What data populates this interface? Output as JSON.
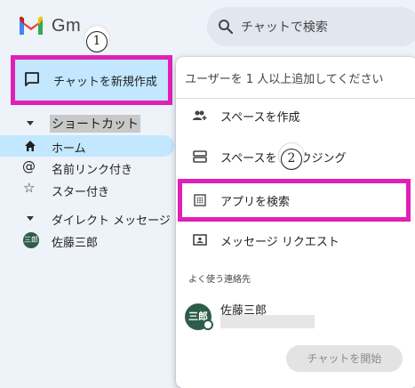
{
  "header": {
    "logo_text": "Gm",
    "search_placeholder": "チャットで検索"
  },
  "callouts": [
    "1",
    "2"
  ],
  "sidebar": {
    "new_chat_label": "チャットを新規作成",
    "items": [
      {
        "label": "ショートカット",
        "icon": "caret-down-icon"
      },
      {
        "label": "ホーム",
        "icon": "home-icon",
        "selected": true
      },
      {
        "label": "名前リンク付き",
        "icon": "at-icon"
      },
      {
        "label": "スター付き",
        "icon": "star-icon"
      },
      {
        "label": "ダイレクト メッセージ",
        "icon": "caret-down-icon"
      },
      {
        "label": "佐藤三郎",
        "icon": "avatar"
      }
    ],
    "avatar_text": "三郎"
  },
  "menu": {
    "input_placeholder": "ユーザーを 1 人以上追加してください",
    "items": [
      {
        "label": "スペースを作成",
        "icon": "group-add-icon"
      },
      {
        "label": "スペースをブラウジング",
        "icon": "browse-spaces-icon"
      },
      {
        "label": "アプリを検索",
        "icon": "apps-grid-icon"
      },
      {
        "label": "メッセージ リクエスト",
        "icon": "message-request-icon"
      }
    ],
    "frequent_label": "よく使う連絡先",
    "contact": {
      "name": "佐藤三郎",
      "avatar_text": "三郎"
    },
    "start_chat_label": "チャットを開始"
  },
  "colors": {
    "highlight_border": "#e020b6",
    "selected_bg": "#c2e7ff",
    "avatar_bg": "#2d5d4a"
  }
}
